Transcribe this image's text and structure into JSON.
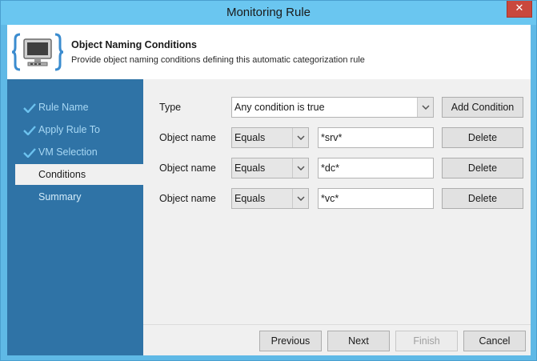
{
  "window": {
    "title": "Monitoring Rule",
    "close_glyph": "✕"
  },
  "header": {
    "icon": "monitor-braces-icon",
    "title": "Object Naming Conditions",
    "subtitle": "Provide object naming conditions defining this automatic categorization rule"
  },
  "nav": [
    {
      "label": "Rule Name",
      "state": "completed"
    },
    {
      "label": "Apply Rule To",
      "state": "completed"
    },
    {
      "label": "VM Selection",
      "state": "completed"
    },
    {
      "label": "Conditions",
      "state": "active"
    },
    {
      "label": "Summary",
      "state": "pending"
    }
  ],
  "type_row": {
    "label": "Type",
    "value": "Any condition is true",
    "add_button": "Add Condition"
  },
  "conditions": [
    {
      "label": "Object name",
      "operator": "Equals",
      "value": "*srv*",
      "delete": "Delete"
    },
    {
      "label": "Object name",
      "operator": "Equals",
      "value": "*dc*",
      "delete": "Delete"
    },
    {
      "label": "Object name",
      "operator": "Equals",
      "value": "*vc*",
      "delete": "Delete"
    }
  ],
  "footer": {
    "previous": "Previous",
    "next": "Next",
    "finish": "Finish",
    "cancel": "Cancel"
  },
  "colors": {
    "titlebar": "#6ac6f0",
    "sidebar": "#2f73a6",
    "close": "#c9483d",
    "check": "#6cc2ef"
  }
}
